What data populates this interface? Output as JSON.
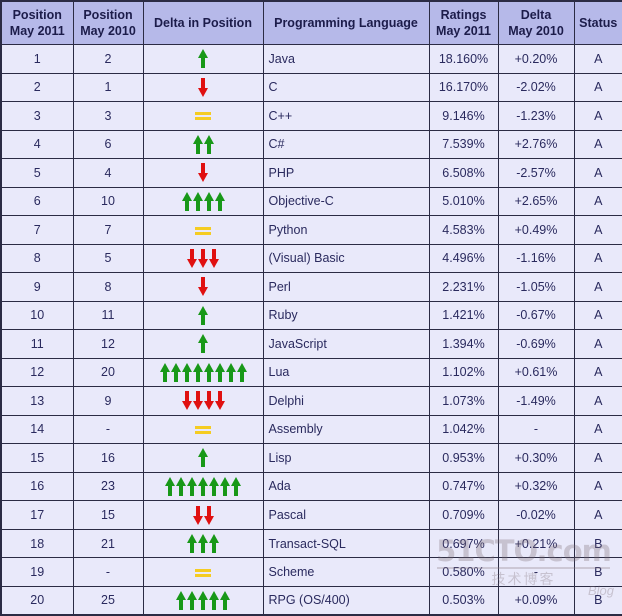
{
  "table": {
    "columns": [
      {
        "key": "pos2011",
        "line1": "Position",
        "line2": "May 2011"
      },
      {
        "key": "pos2010",
        "line1": "Position",
        "line2": "May 2010"
      },
      {
        "key": "delta",
        "line1": "Delta in Position",
        "line2": ""
      },
      {
        "key": "lang",
        "line1": "Programming Language",
        "line2": ""
      },
      {
        "key": "rating",
        "line1": "Ratings",
        "line2": "May 2011"
      },
      {
        "key": "dratio",
        "line1": "Delta",
        "line2": "May 2010"
      },
      {
        "key": "status",
        "line1": "Status",
        "line2": ""
      }
    ],
    "rows": [
      {
        "pos2011": "1",
        "pos2010": "2",
        "delta_dir": "up",
        "delta_count": 1,
        "lang": "Java",
        "rating": "18.160%",
        "dratio": "+0.20%",
        "status": "A"
      },
      {
        "pos2011": "2",
        "pos2010": "1",
        "delta_dir": "down",
        "delta_count": 1,
        "lang": "C",
        "rating": "16.170%",
        "dratio": "-2.02%",
        "status": "A"
      },
      {
        "pos2011": "3",
        "pos2010": "3",
        "delta_dir": "equal",
        "delta_count": 0,
        "lang": "C++",
        "rating": "9.146%",
        "dratio": "-1.23%",
        "status": "A"
      },
      {
        "pos2011": "4",
        "pos2010": "6",
        "delta_dir": "up",
        "delta_count": 2,
        "lang": "C#",
        "rating": "7.539%",
        "dratio": "+2.76%",
        "status": "A"
      },
      {
        "pos2011": "5",
        "pos2010": "4",
        "delta_dir": "down",
        "delta_count": 1,
        "lang": "PHP",
        "rating": "6.508%",
        "dratio": "-2.57%",
        "status": "A"
      },
      {
        "pos2011": "6",
        "pos2010": "10",
        "delta_dir": "up",
        "delta_count": 4,
        "lang": "Objective-C",
        "rating": "5.010%",
        "dratio": "+2.65%",
        "status": "A"
      },
      {
        "pos2011": "7",
        "pos2010": "7",
        "delta_dir": "equal",
        "delta_count": 0,
        "lang": "Python",
        "rating": "4.583%",
        "dratio": "+0.49%",
        "status": "A"
      },
      {
        "pos2011": "8",
        "pos2010": "5",
        "delta_dir": "down",
        "delta_count": 3,
        "lang": "(Visual) Basic",
        "rating": "4.496%",
        "dratio": "-1.16%",
        "status": "A"
      },
      {
        "pos2011": "9",
        "pos2010": "8",
        "delta_dir": "down",
        "delta_count": 1,
        "lang": "Perl",
        "rating": "2.231%",
        "dratio": "-1.05%",
        "status": "A"
      },
      {
        "pos2011": "10",
        "pos2010": "11",
        "delta_dir": "up",
        "delta_count": 1,
        "lang": "Ruby",
        "rating": "1.421%",
        "dratio": "-0.67%",
        "status": "A"
      },
      {
        "pos2011": "11",
        "pos2010": "12",
        "delta_dir": "up",
        "delta_count": 1,
        "lang": "JavaScript",
        "rating": "1.394%",
        "dratio": "-0.69%",
        "status": "A"
      },
      {
        "pos2011": "12",
        "pos2010": "20",
        "delta_dir": "up",
        "delta_count": 8,
        "lang": "Lua",
        "rating": "1.102%",
        "dratio": "+0.61%",
        "status": "A"
      },
      {
        "pos2011": "13",
        "pos2010": "9",
        "delta_dir": "down",
        "delta_count": 4,
        "lang": "Delphi",
        "rating": "1.073%",
        "dratio": "-1.49%",
        "status": "A"
      },
      {
        "pos2011": "14",
        "pos2010": "-",
        "delta_dir": "equal",
        "delta_count": 0,
        "lang": "Assembly",
        "rating": "1.042%",
        "dratio": "-",
        "status": "A"
      },
      {
        "pos2011": "15",
        "pos2010": "16",
        "delta_dir": "up",
        "delta_count": 1,
        "lang": "Lisp",
        "rating": "0.953%",
        "dratio": "+0.30%",
        "status": "A"
      },
      {
        "pos2011": "16",
        "pos2010": "23",
        "delta_dir": "up",
        "delta_count": 7,
        "lang": "Ada",
        "rating": "0.747%",
        "dratio": "+0.32%",
        "status": "A"
      },
      {
        "pos2011": "17",
        "pos2010": "15",
        "delta_dir": "down",
        "delta_count": 2,
        "lang": "Pascal",
        "rating": "0.709%",
        "dratio": "-0.02%",
        "status": "A"
      },
      {
        "pos2011": "18",
        "pos2010": "21",
        "delta_dir": "up",
        "delta_count": 3,
        "lang": "Transact-SQL",
        "rating": "0.697%",
        "dratio": "+0.21%",
        "status": "B"
      },
      {
        "pos2011": "19",
        "pos2010": "-",
        "delta_dir": "equal",
        "delta_count": 0,
        "lang": "Scheme",
        "rating": "0.580%",
        "dratio": "-",
        "status": "B"
      },
      {
        "pos2011": "20",
        "pos2010": "25",
        "delta_dir": "up",
        "delta_count": 5,
        "lang": "RPG (OS/400)",
        "rating": "0.503%",
        "dratio": "+0.09%",
        "status": "B"
      }
    ]
  },
  "watermark": {
    "main": "51CTO.com",
    "sub": "技术博客",
    "blog": "Blog"
  },
  "colors": {
    "header_bg": "#b6b9e9",
    "cell_bg": "#e9e9fa",
    "border": "#2b2b44",
    "text": "#2a2a5e",
    "lang_text": "#32328c",
    "arrow_up": "#189818",
    "arrow_down": "#e01010",
    "equal": "#f5cc22"
  }
}
